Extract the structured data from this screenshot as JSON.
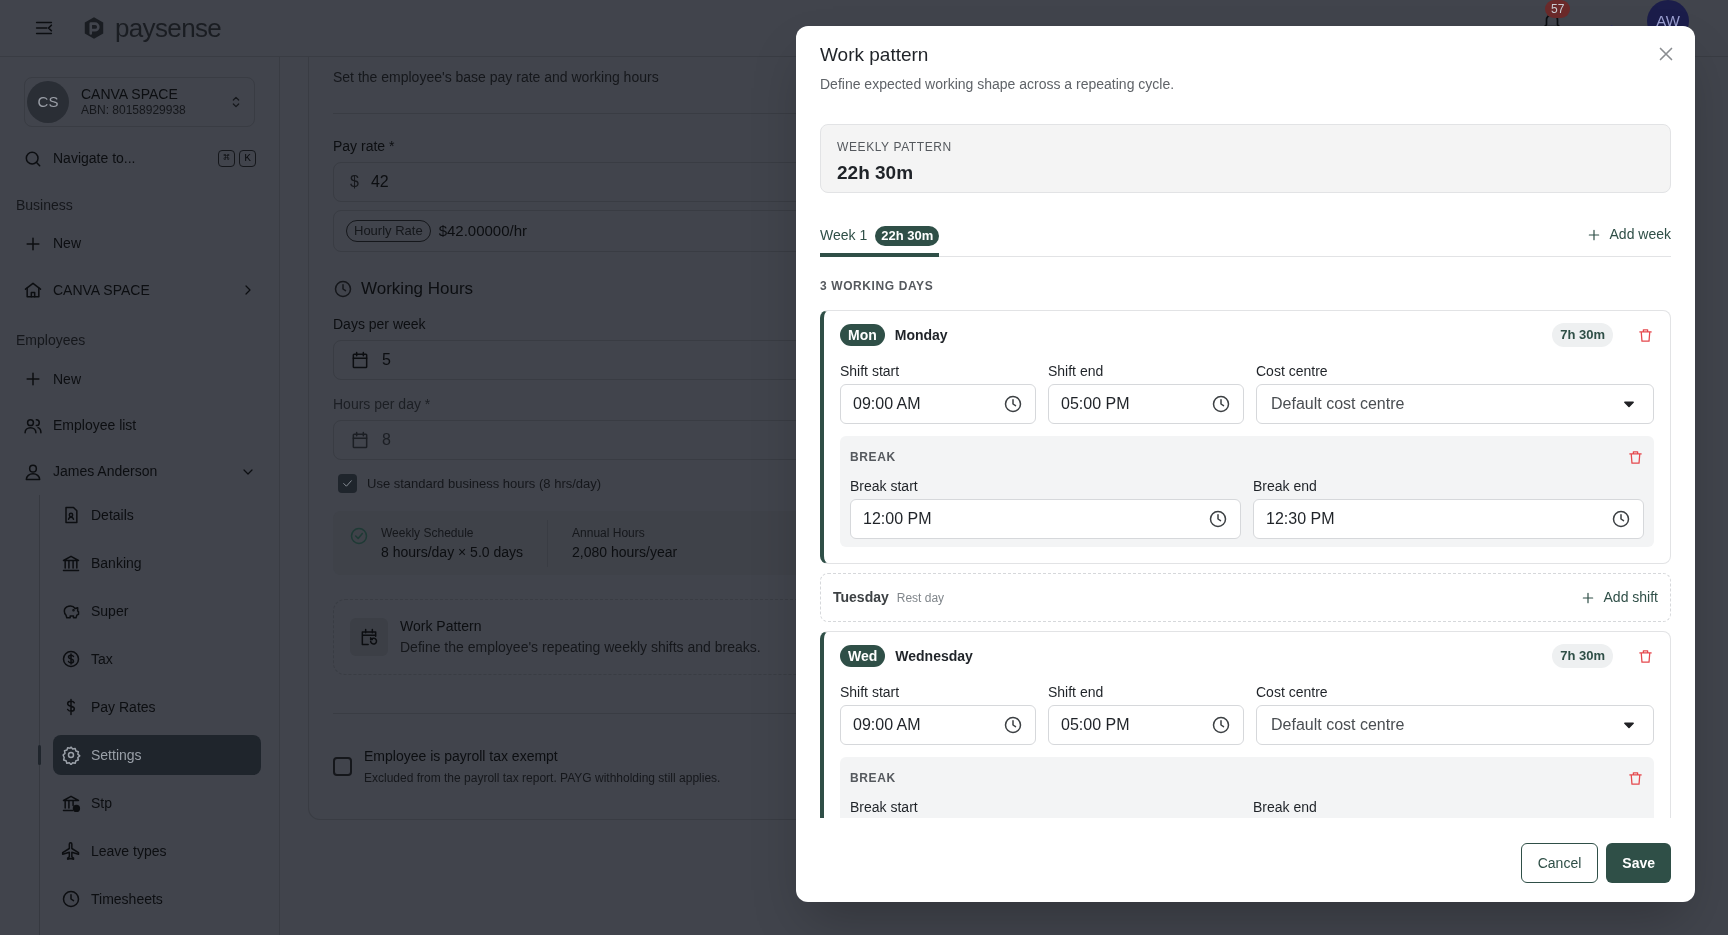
{
  "header": {
    "brand": "paysense",
    "notifications": "57",
    "avatar": "AW"
  },
  "sidebar": {
    "org": {
      "initials": "CS",
      "name": "CANVA SPACE",
      "abn": "ABN: 80158929938"
    },
    "search": {
      "label": "Navigate to...",
      "shortcut": [
        "⌘",
        "K"
      ]
    },
    "sections": [
      {
        "heading": "Business",
        "items": [
          {
            "label": "New"
          },
          {
            "label": "CANVA SPACE"
          }
        ]
      },
      {
        "heading": "Employees",
        "items": [
          {
            "label": "New"
          },
          {
            "label": "Employee list"
          },
          {
            "label": "James Anderson",
            "expanded": true,
            "children": [
              {
                "label": "Details",
                "selected": false
              },
              {
                "label": "Banking",
                "selected": false
              },
              {
                "label": "Super",
                "selected": false
              },
              {
                "label": "Tax",
                "selected": false
              },
              {
                "label": "Pay Rates",
                "selected": false
              },
              {
                "label": "Settings",
                "selected": true
              },
              {
                "label": "Stp",
                "selected": false
              },
              {
                "label": "Leave types",
                "selected": false
              },
              {
                "label": "Timesheets",
                "selected": false
              }
            ]
          }
        ]
      }
    ]
  },
  "main": {
    "intro": "Set the employee's base pay rate and working hours",
    "pay_rate": {
      "label": "Pay rate *",
      "prefix": "$",
      "value": "42"
    },
    "rate_summary": {
      "badge": "Hourly Rate",
      "value": "$42.00000/hr"
    },
    "working_hours_title": "Working Hours",
    "days_per_week": {
      "label": "Days per week",
      "value": "5",
      "disabled": false
    },
    "hours_per_day": {
      "label": "Hours per day *",
      "value": "8",
      "disabled": true
    },
    "standard_hours": {
      "label": "Use standard business hours (8 hrs/day)",
      "checked": true
    },
    "schedule": [
      {
        "label": "Weekly Schedule",
        "value": "8 hours/day × 5.0 days"
      },
      {
        "label": "Annual Hours",
        "value": "2,080 hours/year"
      }
    ],
    "work_pattern": {
      "title": "Work Pattern",
      "description": "Define the employee's repeating weekly shifts and breaks."
    },
    "tax_exempt": {
      "label": "Employee is payroll tax exempt",
      "description": "Excluded from the payroll tax report. PAYG withholding still applies.",
      "checked": false
    }
  },
  "modal": {
    "title": "Work pattern",
    "subtitle": "Define expected working shape across a repeating cycle.",
    "summary": {
      "label": "WEEKLY PATTERN",
      "value": "22h 30m"
    },
    "tabs": [
      {
        "label": "Week 1",
        "badge": "22h 30m",
        "selected": true
      }
    ],
    "add_week": "Add week",
    "working_days_label": "3 WORKING DAYS",
    "days": [
      {
        "kind": "shift",
        "abbr": "Mon",
        "name": "Monday",
        "total": "7h 30m",
        "shift_start": {
          "label": "Shift start",
          "value": "09:00 AM"
        },
        "shift_end": {
          "label": "Shift end",
          "value": "05:00 PM"
        },
        "cost_centre": {
          "label": "Cost centre",
          "value": "Default cost centre"
        },
        "break": {
          "title": "BREAK",
          "start_label": "Break start",
          "start_value": "12:00 PM",
          "end_label": "Break end",
          "end_value": "12:30 PM"
        }
      },
      {
        "kind": "rest",
        "name": "Tuesday",
        "note": "Rest day",
        "action": "Add shift"
      },
      {
        "kind": "shift",
        "abbr": "Wed",
        "name": "Wednesday",
        "total": "7h 30m",
        "shift_start": {
          "label": "Shift start",
          "value": "09:00 AM"
        },
        "shift_end": {
          "label": "Shift end",
          "value": "05:00 PM"
        },
        "cost_centre": {
          "label": "Cost centre",
          "value": "Default cost centre"
        },
        "break": {
          "title": "BREAK",
          "start_label": "Break start",
          "end_label": "Break end"
        }
      }
    ],
    "cancel": "Cancel",
    "save": "Save"
  }
}
